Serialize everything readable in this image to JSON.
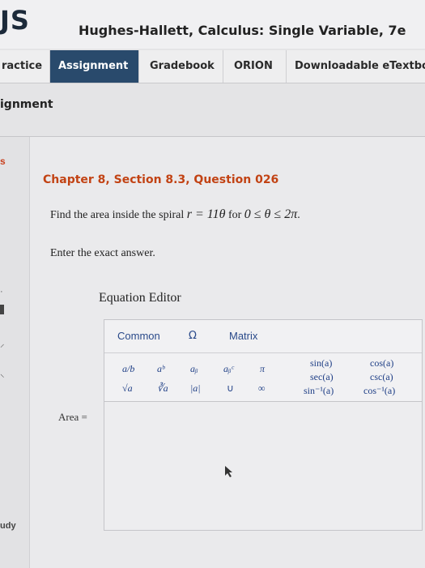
{
  "header": {
    "logo_text": "JS",
    "course_title": "Hughes-Hallett, Calculus: Single Variable, 7e"
  },
  "nav": {
    "tabs": [
      {
        "label": "ractice",
        "active": false
      },
      {
        "label": "Assignment",
        "active": true
      },
      {
        "label": "Gradebook",
        "active": false
      },
      {
        "label": "ORION",
        "active": false
      },
      {
        "label": "Downloadable eTextbo",
        "active": false
      }
    ]
  },
  "page": {
    "heading": "ignment"
  },
  "left_rail": {
    "s_marker": "s",
    "study_label": "udy"
  },
  "question": {
    "title": "Chapter 8, Section 8.3, Question 026",
    "text_prefix": "Find the area inside the spiral ",
    "equation": "r = 11θ",
    "text_middle": " for ",
    "range": "0 ≤ θ ≤ 2π",
    "text_suffix": ".",
    "instruction": "Enter the exact answer."
  },
  "equation_editor": {
    "label": "Equation Editor",
    "tabs": [
      "Common",
      "Ω",
      "Matrix"
    ],
    "symbols_row1": [
      "a/b",
      "aᵇ",
      "aᵦ",
      "aᵦᶜ",
      "π"
    ],
    "symbols_row2": [
      "√a",
      "∛a",
      "|a|",
      "∪",
      "∞"
    ],
    "trig": {
      "col1": [
        "sin(a)",
        "sec(a)",
        "sin⁻¹(a)"
      ],
      "col2": [
        "cos(a)",
        "csc(a)",
        "cos⁻¹(a)"
      ]
    }
  },
  "answer": {
    "label": "Area ="
  }
}
